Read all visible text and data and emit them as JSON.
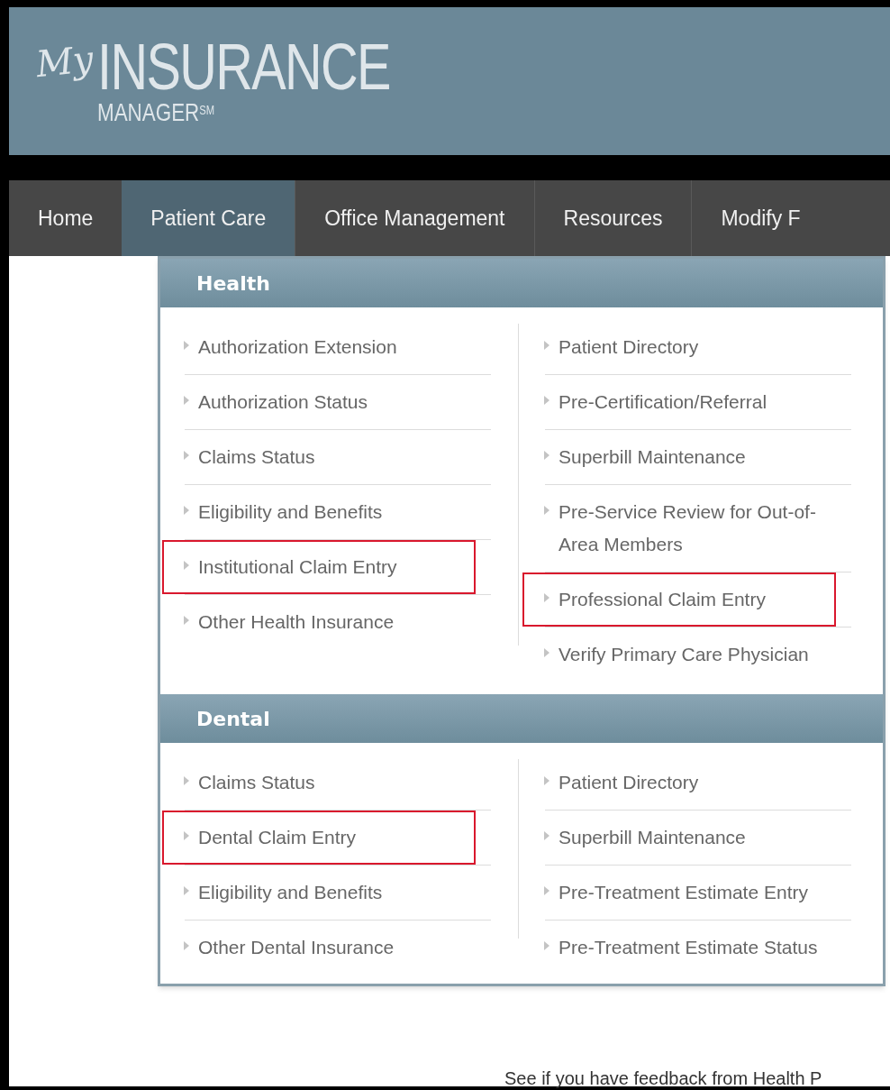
{
  "logo": {
    "script": "My",
    "main": "INSURANCE",
    "sub": "MANAGER",
    "mark": "SM"
  },
  "nav": [
    {
      "label": "Home",
      "selected": false
    },
    {
      "label": "Patient Care",
      "selected": true
    },
    {
      "label": "Office Management",
      "selected": false
    },
    {
      "label": "Resources",
      "selected": false
    },
    {
      "label": "Modify F",
      "selected": false
    }
  ],
  "menu_sections": [
    {
      "title": "Health",
      "columns": [
        [
          {
            "label": "Authorization Extension",
            "highlighted": false
          },
          {
            "label": "Authorization Status",
            "highlighted": false
          },
          {
            "label": "Claims Status",
            "highlighted": false
          },
          {
            "label": "Eligibility and Benefits",
            "highlighted": false
          },
          {
            "label": "Institutional Claim Entry",
            "highlighted": true
          },
          {
            "label": "Other Health Insurance",
            "highlighted": false
          }
        ],
        [
          {
            "label": "Patient Directory",
            "highlighted": false
          },
          {
            "label": "Pre-Certification/Referral",
            "highlighted": false
          },
          {
            "label": "Superbill Maintenance",
            "highlighted": false
          },
          {
            "label": "Pre-Service Review for Out-of-Area Members",
            "highlighted": false
          },
          {
            "label": "Professional Claim Entry",
            "highlighted": true
          },
          {
            "label": "Verify Primary Care Physician",
            "highlighted": false
          }
        ]
      ]
    },
    {
      "title": "Dental",
      "columns": [
        [
          {
            "label": "Claims Status",
            "highlighted": false
          },
          {
            "label": "Dental Claim Entry",
            "highlighted": true
          },
          {
            "label": "Eligibility and Benefits",
            "highlighted": false
          },
          {
            "label": "Other Dental Insurance",
            "highlighted": false
          }
        ],
        [
          {
            "label": "Patient Directory",
            "highlighted": false
          },
          {
            "label": "Superbill Maintenance",
            "highlighted": false
          },
          {
            "label": "Pre-Treatment Estimate Entry",
            "highlighted": false
          },
          {
            "label": "Pre-Treatment Estimate Status",
            "highlighted": false
          }
        ]
      ]
    }
  ],
  "page_text": "See if you have feedback from Health P"
}
